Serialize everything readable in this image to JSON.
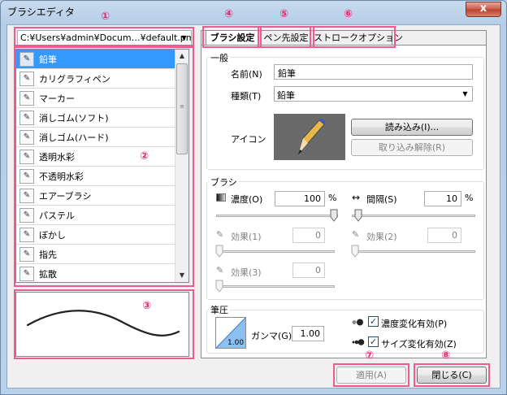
{
  "window": {
    "title": "ブラシエディタ",
    "close_glyph": "x"
  },
  "annotations": [
    "①",
    "②",
    "③",
    "④",
    "⑤",
    "⑥",
    "⑦",
    "⑧"
  ],
  "file_combo": {
    "value": "C:¥Users¥admin¥Docum…¥default.pmt*",
    "arrow": "▼"
  },
  "brush_list": {
    "items": [
      {
        "label": "鉛筆",
        "icon": "pencil-icon",
        "selected": true
      },
      {
        "label": "カリグラフィペン",
        "icon": "calligraphy-pen-icon"
      },
      {
        "label": "マーカー",
        "icon": "marker-icon"
      },
      {
        "label": "消しゴム(ソフト)",
        "icon": "soft-eraser-icon"
      },
      {
        "label": "消しゴム(ハード)",
        "icon": "hard-eraser-icon"
      },
      {
        "label": "透明水彩",
        "icon": "transparent-watercolor-icon"
      },
      {
        "label": "不透明水彩",
        "icon": "opaque-watercolor-icon"
      },
      {
        "label": "エアーブラシ",
        "icon": "airbrush-icon"
      },
      {
        "label": "パステル",
        "icon": "pastel-icon"
      },
      {
        "label": "ぼかし",
        "icon": "blur-icon"
      },
      {
        "label": "指先",
        "icon": "finger-icon"
      },
      {
        "label": "拡散",
        "icon": "diffuse-icon"
      }
    ],
    "scroll_up": "▲",
    "scroll_down": "▼",
    "scroll_grip": "≡"
  },
  "tabs": [
    {
      "label": "ブラシ設定",
      "active": true
    },
    {
      "label": "ペン先設定"
    },
    {
      "label": "ストロークオプション"
    }
  ],
  "general": {
    "title": "一般",
    "name_label": "名前(N)",
    "name_value": "鉛筆",
    "type_label": "種類(T)",
    "type_value": "鉛筆",
    "type_arrow": "▼",
    "icon_label": "アイコン",
    "load_button": "読み込み(I)...",
    "unload_button": "取り込み解除(R)"
  },
  "brush": {
    "title": "ブラシ",
    "density_label": "濃度(O)",
    "density_value": "100",
    "density_unit": "%",
    "density_level": 1.0,
    "interval_label": "間隔(S)",
    "interval_value": "10",
    "interval_unit": "%",
    "interval_level": 0.02,
    "effect1_label": "効果(1)",
    "effect1_value": "0",
    "effect2_label": "効果(2)",
    "effect2_value": "0",
    "effect3_label": "効果(3)",
    "effect3_value": "0"
  },
  "pressure": {
    "title": "筆圧",
    "gamma_label": "ガンマ(G)",
    "gamma_value": "1.00",
    "gamma_box_value": "1.00",
    "density_toggle_label": "濃度変化有効(P)",
    "density_toggle_checked": true,
    "size_toggle_label": "サイズ変化有効(Z)",
    "size_toggle_checked": true,
    "check_glyph": "✓"
  },
  "footer": {
    "apply_button": "適用(A)",
    "close_button": "閉じる(C)"
  },
  "colors": {
    "selection": "#3399ff",
    "annotation": "#e3256b"
  }
}
